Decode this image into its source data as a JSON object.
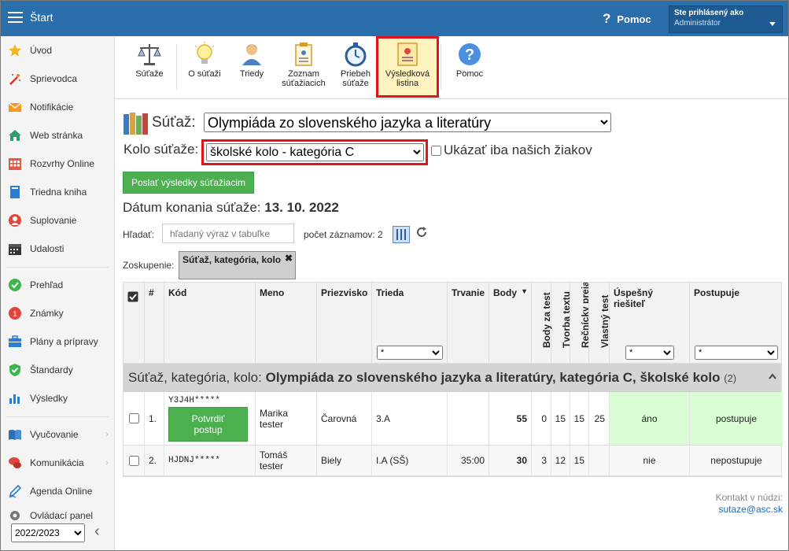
{
  "topbar": {
    "title": "Štart",
    "help": "Pomoc",
    "user_line1": "Ste prihlásený ako",
    "user_line2": "Administrátor"
  },
  "sidebar": {
    "items": [
      {
        "label": "Úvod",
        "icon": "star-icon"
      },
      {
        "label": "Sprievodca",
        "icon": "magic-wand-icon"
      },
      {
        "label": "Notifikácie",
        "icon": "envelope-icon"
      },
      {
        "label": "Web stránka",
        "icon": "home-icon"
      },
      {
        "label": "Rozvrhy Online",
        "icon": "calendar-grid-icon"
      },
      {
        "label": "Triedna kniha",
        "icon": "book-icon"
      },
      {
        "label": "Suplovanie",
        "icon": "person-icon"
      },
      {
        "label": "Udalosti",
        "icon": "calendar-icon"
      },
      {
        "label": "Prehľad",
        "icon": "check-circle-icon"
      },
      {
        "label": "Známky",
        "icon": "grade-icon"
      },
      {
        "label": "Plány a prípravy",
        "icon": "briefcase-icon"
      },
      {
        "label": "Štandardy",
        "icon": "shield-check-icon"
      },
      {
        "label": "Výsledky",
        "icon": "bar-chart-icon"
      },
      {
        "label": "Vyučovanie",
        "icon": "open-book-icon"
      },
      {
        "label": "Komunikácia",
        "icon": "chat-icon"
      },
      {
        "label": "Agenda Online",
        "icon": "pen-icon"
      },
      {
        "label": "Ovládací panel",
        "icon": "gear-icon"
      }
    ],
    "year": "2022/2023"
  },
  "toolbar": {
    "buttons": [
      {
        "label1": "Súťaže",
        "label2": ""
      },
      {
        "label1": "O súťaži",
        "label2": ""
      },
      {
        "label1": "Triedy",
        "label2": ""
      },
      {
        "label1": "Zoznam",
        "label2": "súťažiacich"
      },
      {
        "label1": "Priebeh",
        "label2": "súťaže"
      },
      {
        "label1": "Výsledková",
        "label2": "listina"
      },
      {
        "label1": "Pomoc",
        "label2": ""
      }
    ]
  },
  "form": {
    "contest_label": "Súťaž:",
    "contest_value": "Olympiáda zo slovenského jazyka a literatúry",
    "round_label": "Kolo súťaže:",
    "round_value": "školské kolo - kategória C",
    "only_ours": "Ukázať iba našich žiakov",
    "send_button": "Poslať výsledky súťažiacim",
    "date_label": "Dátum konania súťaže:",
    "date_value": "13. 10. 2022",
    "search_label": "Hľadať:",
    "search_placeholder": "hľadaný výraz v tabuľke",
    "count_label": "počet záznamov: 2",
    "group_label": "Zoskupenie:",
    "group_chip": "Súťaž, kategória, kolo",
    "group_chip_close": "✖"
  },
  "table": {
    "headers": {
      "num": "#",
      "code": "Kód",
      "name": "Meno",
      "surname": "Priezvisko",
      "class": "Trieda",
      "duration": "Trvanie",
      "points": "Body",
      "points_test": "Body za test",
      "text": "Tvorba textu",
      "speech": "Rečnícky prejav",
      "own_test": "Vlastný test",
      "success1": "Úspešný",
      "success2": "riešiteľ",
      "advances": "Postupuje",
      "filter": "*"
    },
    "group": {
      "prefix": "Súťaž, kategória, kolo: ",
      "title": "Olympiáda zo slovenského jazyka a literatúry, kategória C, školské kolo",
      "count": "(2)"
    },
    "rows": [
      {
        "num": "1.",
        "code": "Y3J4H*****",
        "confirm1": "Potvrdiť",
        "confirm2": "postup",
        "name1": "Marika",
        "name2": "tester",
        "surname": "Čarovná",
        "class": "3.A",
        "duration": "",
        "points": "55",
        "test": "0",
        "text": "15",
        "speech": "15",
        "own": "25",
        "success": "áno",
        "advances": "postupuje"
      },
      {
        "num": "2.",
        "code": "HJDNJ*****",
        "name1": "Tomáš",
        "name2": "tester",
        "surname": "Biely",
        "class": "I.A (SŠ)",
        "duration": "35:00",
        "points": "30",
        "test": "3",
        "text": "12",
        "speech": "15",
        "own": "",
        "success": "nie",
        "advances": "nepostupuje"
      }
    ]
  },
  "contact": {
    "line1": "Kontakt v núdzi:",
    "email": "sutaze@asc.sk"
  },
  "colors": {
    "topbar": "#2a6eab",
    "green": "#4caf50",
    "highlight_red": "#e0151b"
  }
}
